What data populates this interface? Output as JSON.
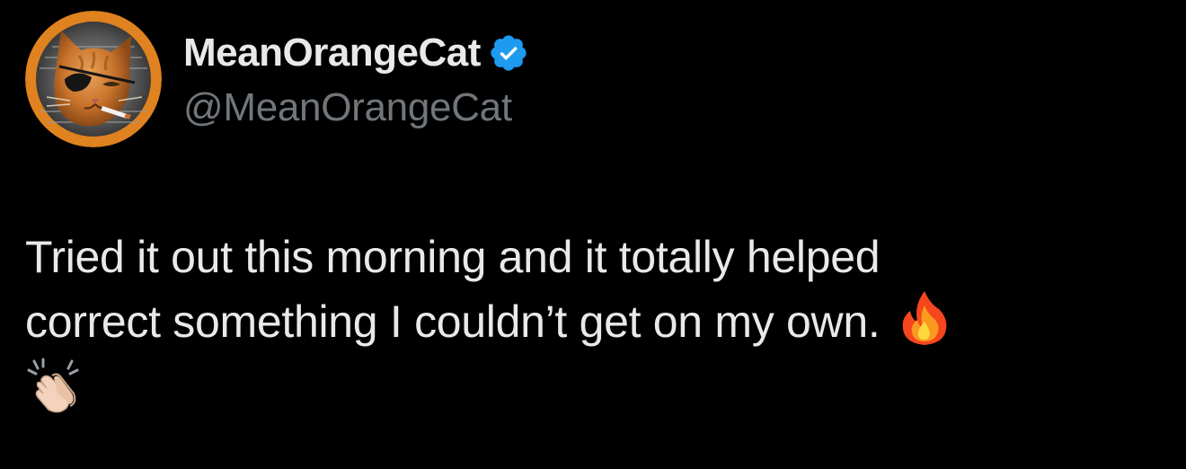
{
  "profile": {
    "display_name": "MeanOrangeCat",
    "handle": "@MeanOrangeCat",
    "verified": true,
    "accent_verified": "#1d9bf0"
  },
  "tweet": {
    "line1": "Tried it out this morning and it totally helped",
    "line2": "correct something I couldn’t get on my own.",
    "emojis": [
      "fire-icon",
      "clapping-hands-icon"
    ]
  },
  "colors": {
    "background": "#000000",
    "text_primary": "#e7e9ea",
    "text_secondary": "#71767b",
    "avatar_ring": "#e0821f"
  }
}
